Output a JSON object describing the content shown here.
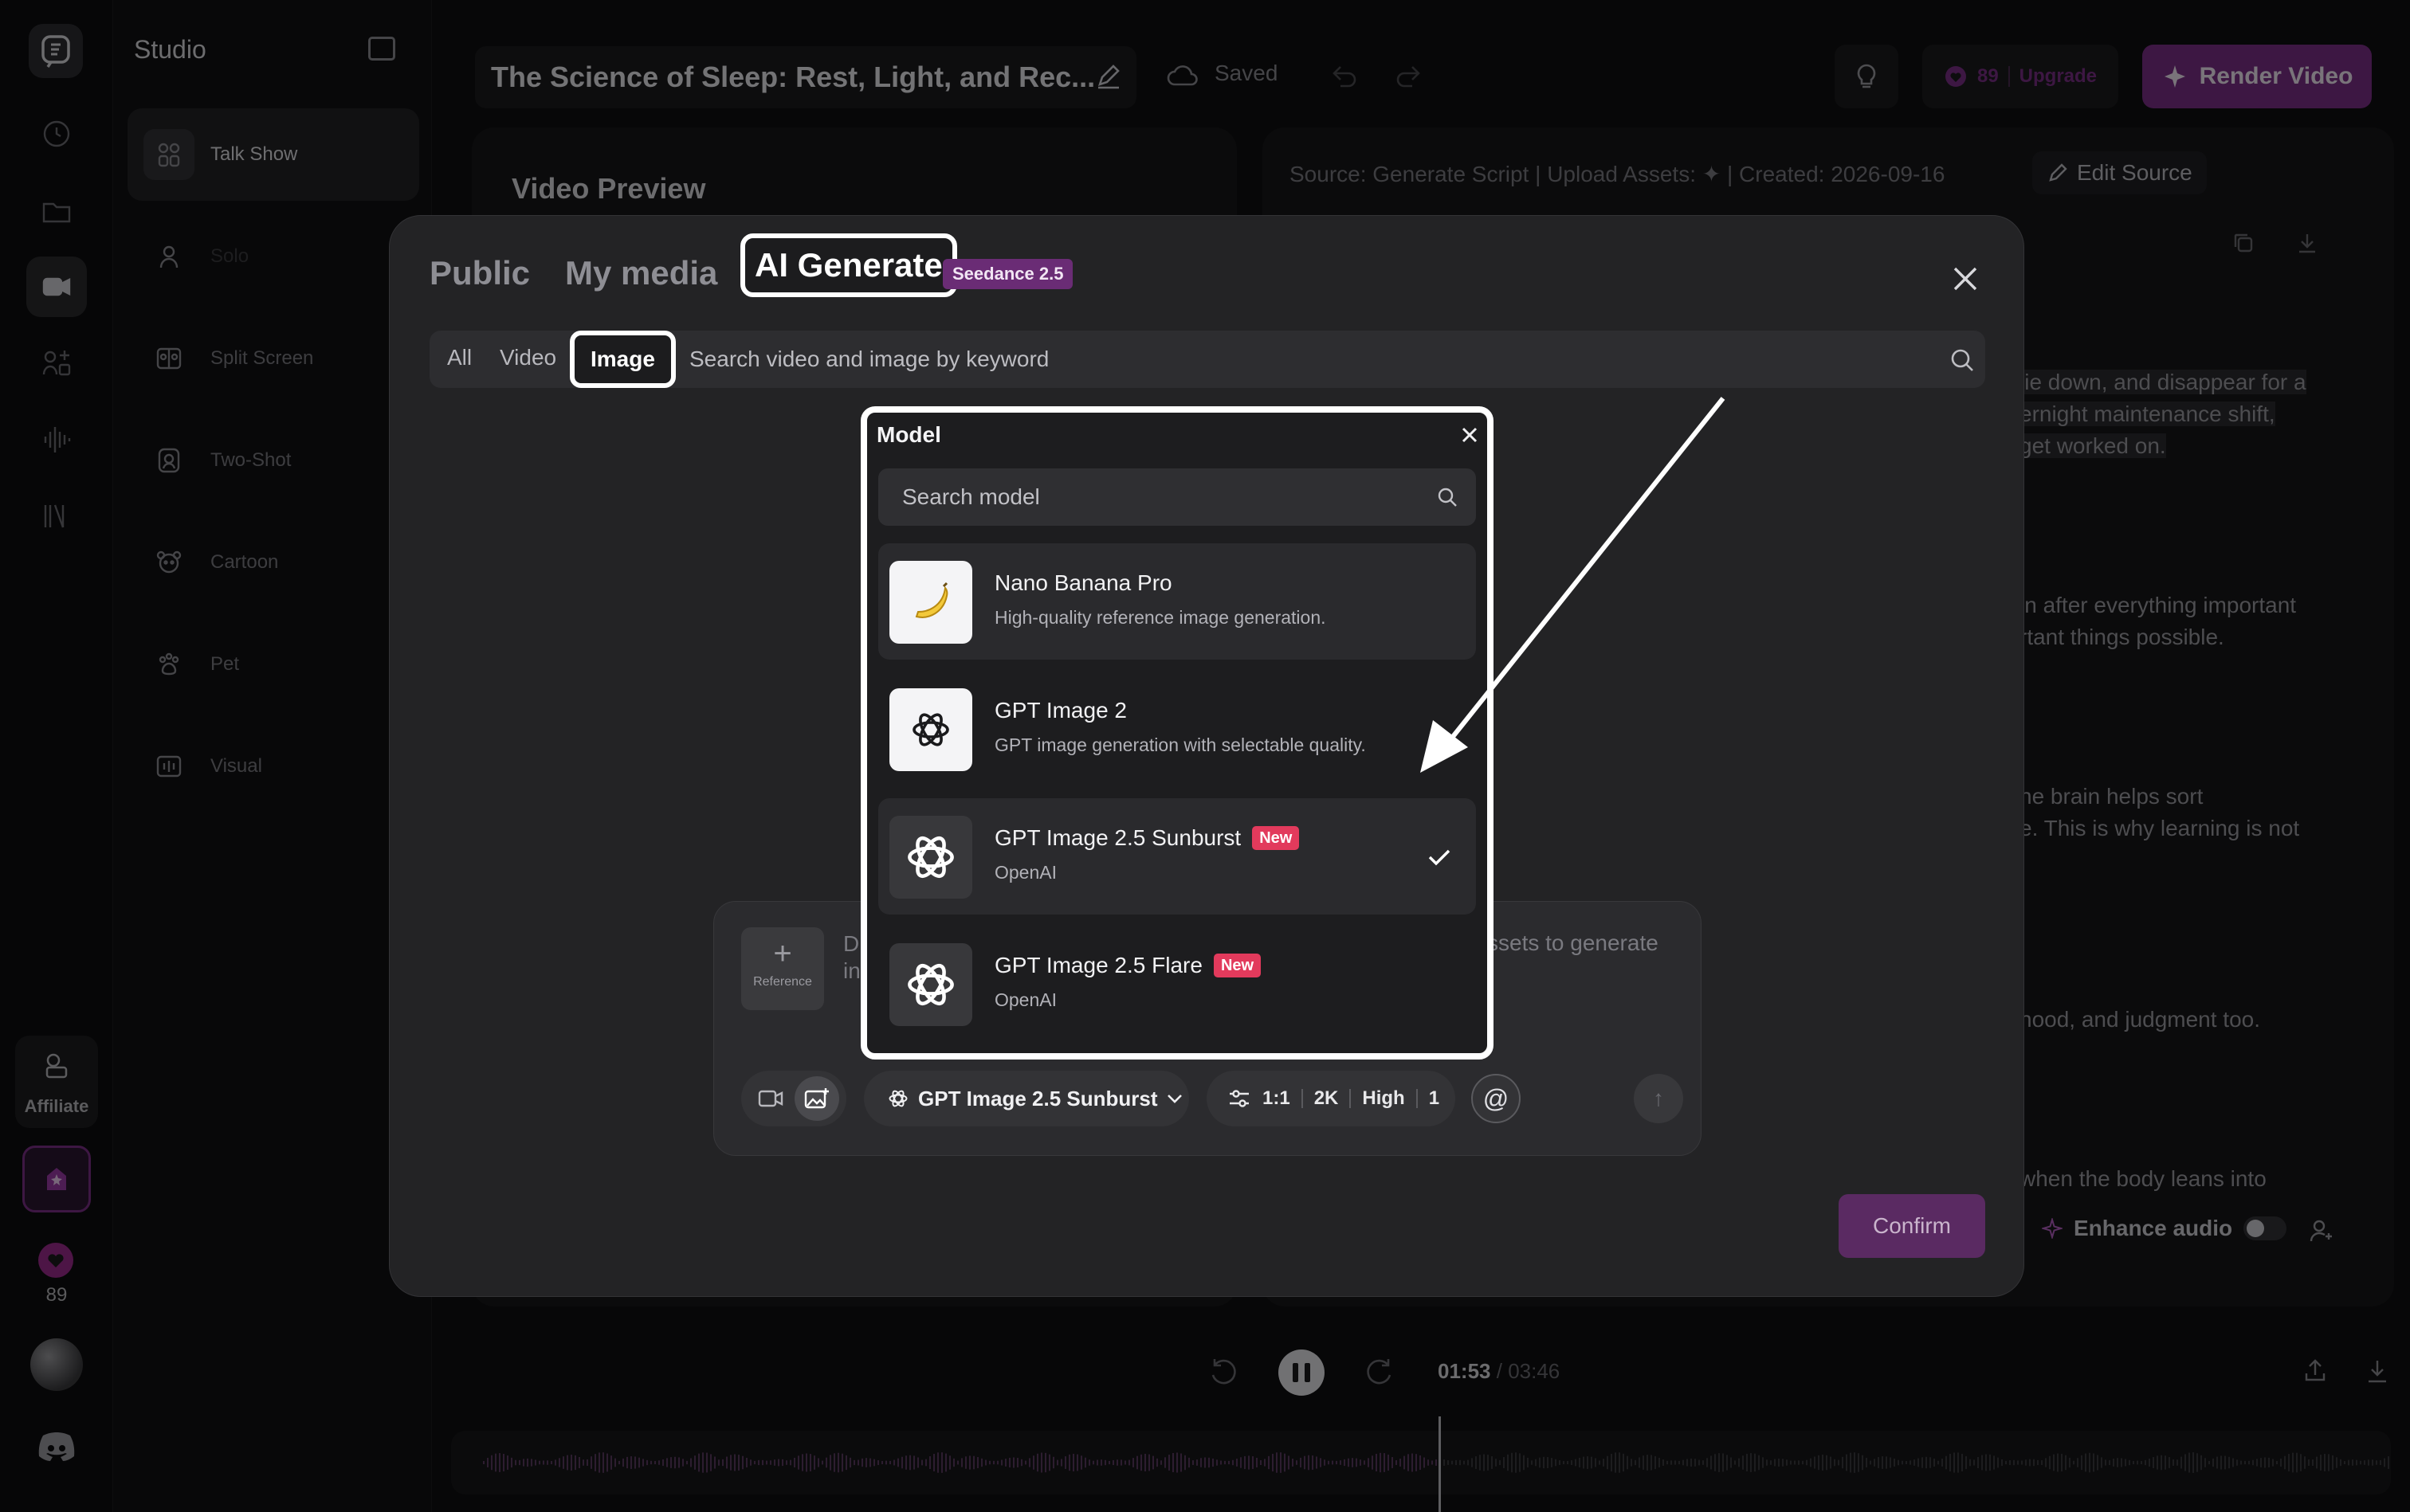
{
  "rail": {
    "affiliate_label": "Affiliate",
    "credits": "89",
    "accent_color": "#7b2f86"
  },
  "studio": {
    "title": "Studio",
    "items": [
      {
        "label": "Talk Show",
        "icon": "talk-show-icon"
      },
      {
        "label": "Solo",
        "icon": "solo-icon"
      },
      {
        "label": "Split Screen",
        "icon": "split-screen-icon"
      },
      {
        "label": "Two-Shot",
        "icon": "two-shot-icon"
      },
      {
        "label": "Cartoon",
        "icon": "cartoon-icon"
      },
      {
        "label": "Pet",
        "icon": "paw-icon"
      },
      {
        "label": "Visual",
        "icon": "visual-icon"
      }
    ]
  },
  "topbar": {
    "project_title": "The Science of Sleep: Rest, Light, and Rec...",
    "saved_label": "Saved",
    "credits": "89",
    "upgrade_label": "Upgrade",
    "render_label": "Render Video"
  },
  "preview": {
    "title": "Video Preview"
  },
  "script": {
    "source_line": "Source: Generate Script  |  Upload Assets:  ✦  |  Created: 2026-09-16",
    "edit_source_label": "Edit Source",
    "fragments": [
      " lie down, and disappear for a",
      "ernight maintenance shift,",
      "get worked on.",
      "in after everything important",
      "rtant things possible.",
      "he brain helps sort",
      "e. This is why learning is not",
      "hood, and judgment too.",
      "when the body leans into"
    ],
    "enhance_audio_label": "Enhance audio"
  },
  "player": {
    "current_time": "01:53",
    "total_time": "03:46"
  },
  "modal": {
    "tabs": [
      "Public",
      "My media",
      "AI Generate"
    ],
    "active_tab": "AI Generate",
    "badge": "Seedance 2.5",
    "filters": [
      "All",
      "Video",
      "Image"
    ],
    "active_filter": "Image",
    "search_placeholder": "Search video and image by keyword",
    "reference_label": "Reference",
    "prompt_placeholder_left": "D\nin",
    "prompt_placeholder_right": "ssets to generate",
    "selected_model": "GPT Image 2.5 Sunburst",
    "params": {
      "ratio": "1:1",
      "resolution": "2K",
      "quality": "High",
      "count": "1"
    },
    "confirm_label": "Confirm"
  },
  "model_dropdown": {
    "title": "Model",
    "search_placeholder": "Search model",
    "models": [
      {
        "name": "Nano Banana Pro",
        "desc": "High-quality reference image generation.",
        "icon": "banana-icon",
        "badge": "",
        "selected": false
      },
      {
        "name": "GPT Image 2",
        "desc": "GPT image generation with selectable quality.",
        "icon": "openai-icon",
        "badge": "",
        "selected": false
      },
      {
        "name": "GPT Image 2.5 Sunburst",
        "desc": "OpenAI",
        "icon": "openai-icon",
        "badge": "New",
        "selected": true
      },
      {
        "name": "GPT Image 2.5 Flare",
        "desc": "OpenAI",
        "icon": "openai-icon",
        "badge": "New",
        "selected": false
      }
    ]
  }
}
